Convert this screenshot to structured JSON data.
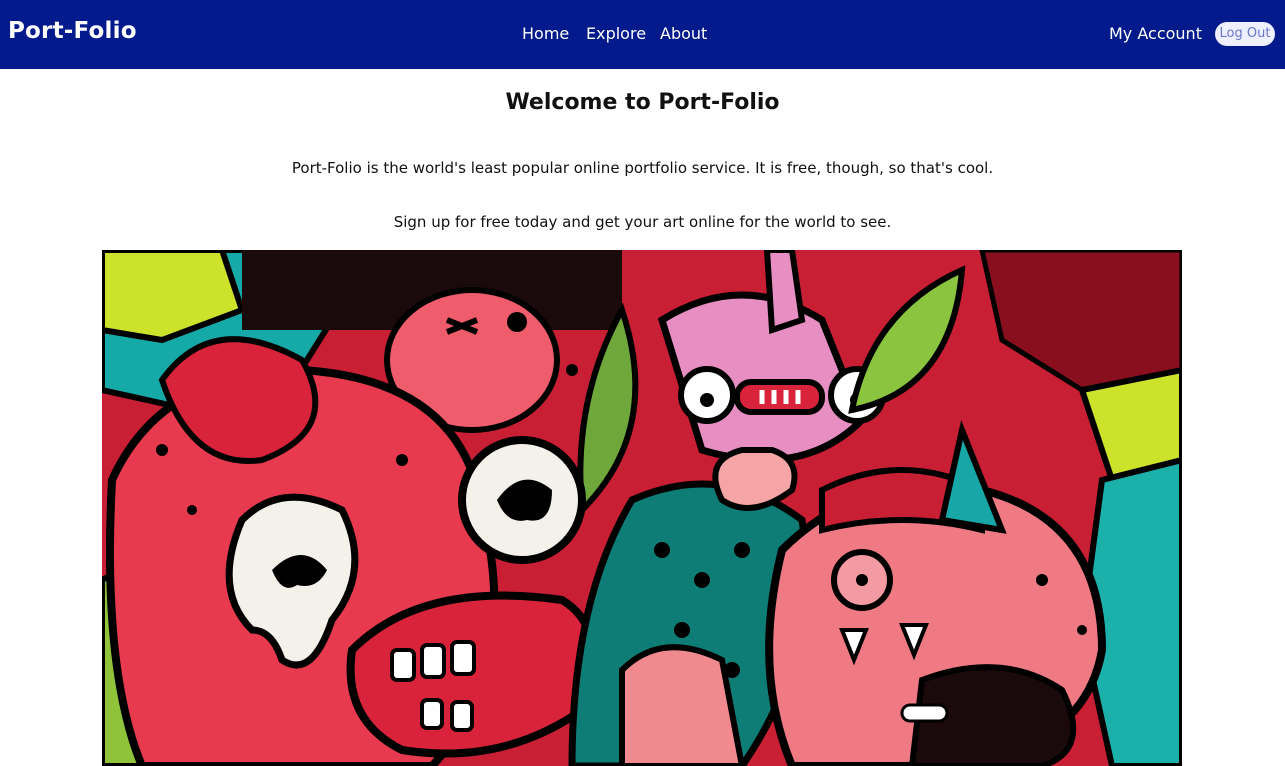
{
  "brand": "Port-Folio",
  "nav": {
    "home": "Home",
    "explore": "Explore",
    "about": "About"
  },
  "account": {
    "my_account": "My Account",
    "logout": "Log Out"
  },
  "main": {
    "title": "Welcome to Port-Folio",
    "intro": "Port-Folio is the world's least popular online portfolio service. It is free, though, so that's cool.",
    "signup": "Sign up for free today and get your art online for the world to see."
  },
  "hero_image": {
    "subject": "colorful graffiti cartoon monsters mural"
  },
  "colors": {
    "navbar": "#021a8c",
    "logout_bg": "#eef0ff",
    "logout_text": "#6b78c8"
  }
}
